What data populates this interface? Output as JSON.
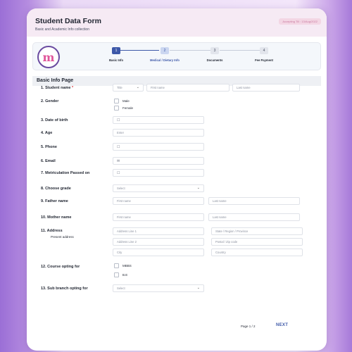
{
  "header": {
    "title": "Student Data Form",
    "subtitle": "Basic and Academic Info collection",
    "badge": "Accepting Till : 13/Aug/2022"
  },
  "logo": {
    "letter": "m"
  },
  "steps": [
    {
      "num": "1",
      "label": "Basic Info"
    },
    {
      "num": "2",
      "label": "Medical / Dietary Info"
    },
    {
      "num": "3",
      "label": "Documents"
    },
    {
      "num": "4",
      "label": "Fee Payment"
    }
  ],
  "section_title": "Basic Info Page",
  "fields": {
    "student_name": {
      "label": "1. Student name",
      "required": "*",
      "title_value": "Title",
      "first_placeholder": "First name",
      "last_placeholder": "Last name"
    },
    "gender": {
      "label": "2. Gender",
      "options": [
        "Male",
        "Female"
      ]
    },
    "dob": {
      "label": "3. Date of birth"
    },
    "age": {
      "label": "4. Age",
      "placeholder": "Enter"
    },
    "phone": {
      "label": "5. Phone"
    },
    "email": {
      "label": "6. Email"
    },
    "matric": {
      "label": "7. Metriculation Passed on"
    },
    "grade": {
      "label": "8. Choose grade",
      "value": "Select"
    },
    "father": {
      "label": "9. Father name",
      "first_placeholder": "First name",
      "last_placeholder": "Last name"
    },
    "mother": {
      "label": "10. Mother name",
      "first_placeholder": "First name",
      "last_placeholder": "Last name"
    },
    "address": {
      "label": "11. Address",
      "sublabel": "Present address",
      "line1": "Address Line 1",
      "state": "State / Region / Province",
      "line2": "Address Line 2",
      "postal": "Postal / Zip code",
      "city": "City",
      "country": "Country"
    },
    "course": {
      "label": "12. Course opting for",
      "options": [
        "MBBS",
        "B.E"
      ]
    },
    "sub_branch": {
      "label": "13. Sub branch opting for",
      "value": "Select"
    }
  },
  "footer": {
    "page": "Page 1 / 2",
    "next": "NEXT"
  },
  "icons": {
    "calendar": "calendar-icon",
    "phone": "phone-icon",
    "email": "email-icon",
    "chevron": "chevron-down-icon"
  },
  "colors": {
    "accent": "#3d58a8",
    "header_bg": "#f6eaf4",
    "required": "#d9353b"
  }
}
